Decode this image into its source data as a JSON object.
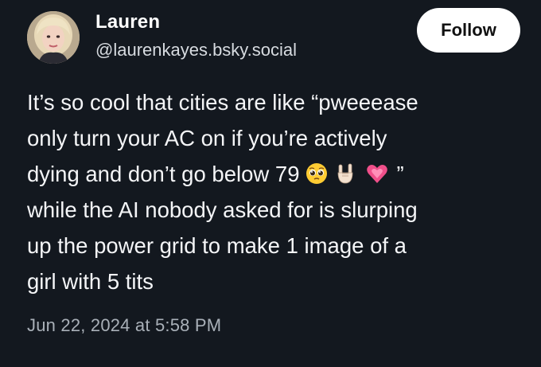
{
  "author": {
    "name": "Lauren",
    "handle": "@laurenkayes.bsky.social"
  },
  "follow_button": {
    "label": "Follow"
  },
  "post": {
    "lines": [
      "It’s so cool that cities are like “pweeease",
      "only turn your AC on if you’re actively",
      "dying and don’t go below 79",
      "”",
      "while the AI nobody asked for is slurping",
      "up the power grid to make 1 image of a",
      "girl with 5 tits"
    ],
    "emojis": [
      "pleading-face-emoji",
      "rock-on-hand-emoji",
      "growing-heart-emoji"
    ],
    "timestamp": "Jun 22, 2024 at 5:58 PM"
  },
  "colors": {
    "background": "#13181f",
    "text": "#f4f5f7",
    "muted": "#a9b0b8",
    "button_bg": "#ffffff"
  }
}
